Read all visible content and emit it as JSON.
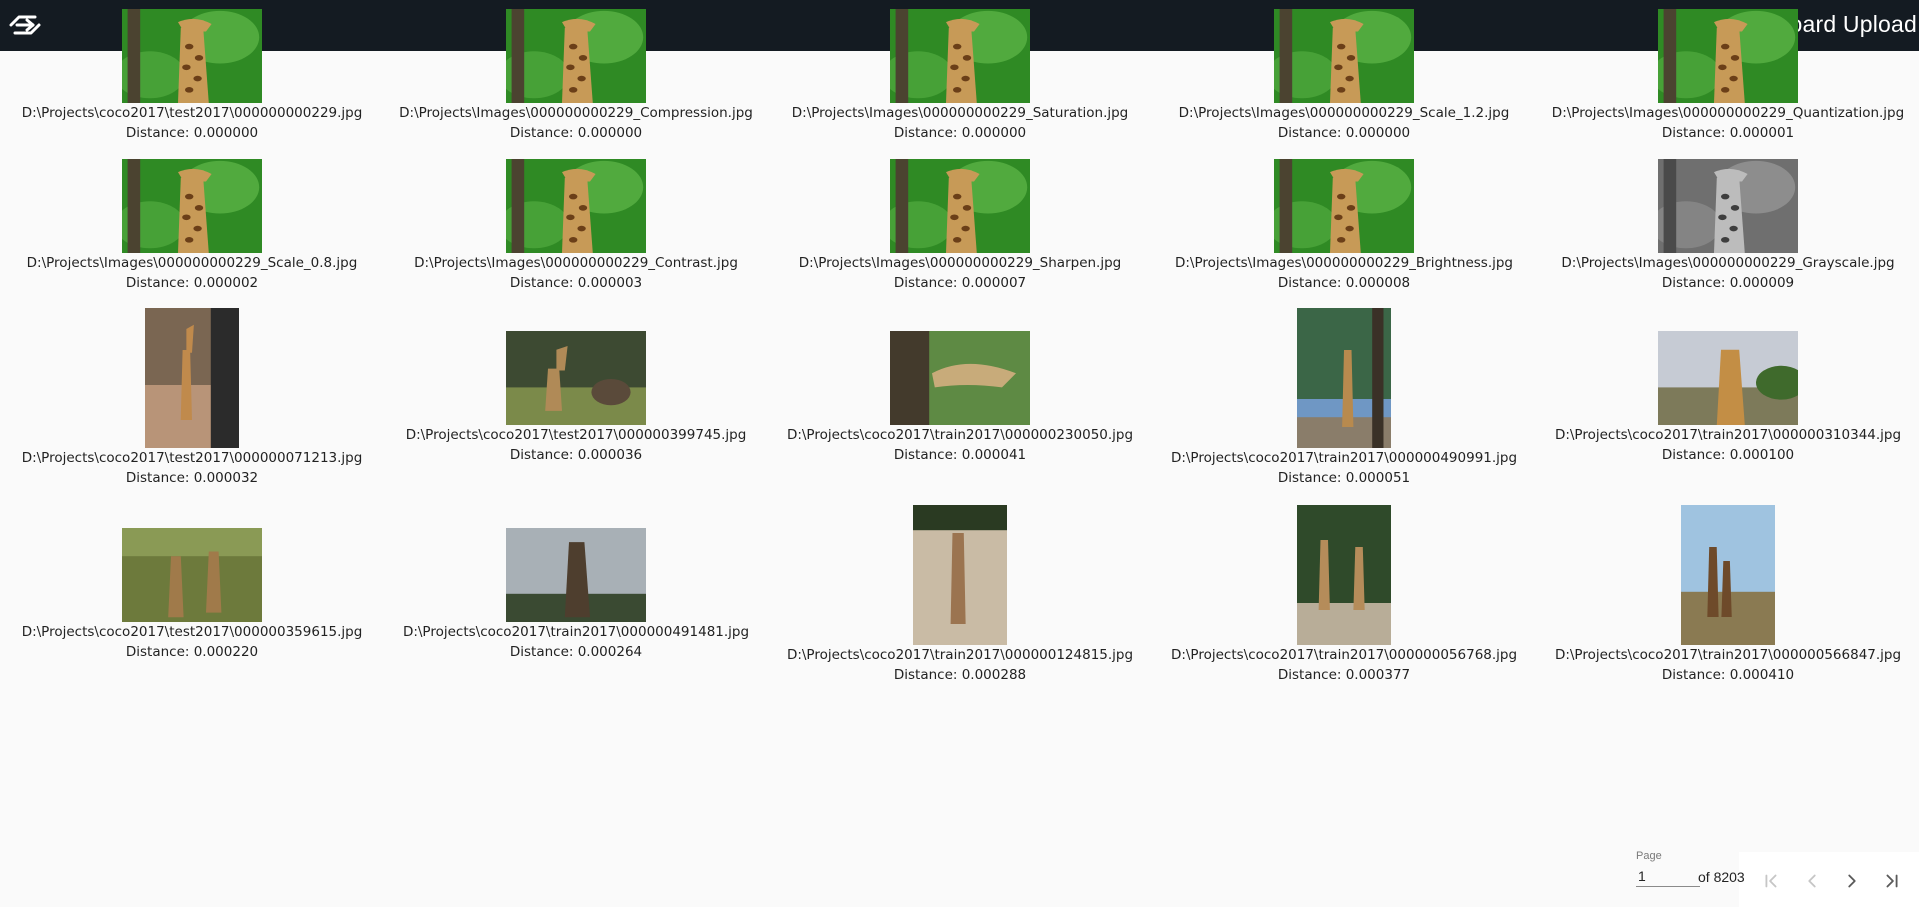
{
  "header": {
    "title": "Dashboard Upload",
    "logo_icon": "logo-icon"
  },
  "results": [
    {
      "path": "D:\\Projects\\coco2017\\test2017\\000000000229.jpg",
      "distance": "Distance: 0.000000",
      "image": "giraffe-trees"
    },
    {
      "path": "D:\\Projects\\Images\\000000000229_Compression.jpg",
      "distance": "Distance: 0.000000",
      "image": "giraffe-trees"
    },
    {
      "path": "D:\\Projects\\Images\\000000000229_Saturation.jpg",
      "distance": "Distance: 0.000000",
      "image": "giraffe-trees"
    },
    {
      "path": "D:\\Projects\\Images\\000000000229_Scale_1.2.jpg",
      "distance": "Distance: 0.000000",
      "image": "giraffe-trees"
    },
    {
      "path": "D:\\Projects\\Images\\000000000229_Quantization.jpg",
      "distance": "Distance: 0.000001",
      "image": "giraffe-trees"
    },
    {
      "path": "D:\\Projects\\Images\\000000000229_Scale_0.8.jpg",
      "distance": "Distance: 0.000002",
      "image": "giraffe-trees"
    },
    {
      "path": "D:\\Projects\\Images\\000000000229_Contrast.jpg",
      "distance": "Distance: 0.000003",
      "image": "giraffe-trees"
    },
    {
      "path": "D:\\Projects\\Images\\000000000229_Sharpen.jpg",
      "distance": "Distance: 0.000007",
      "image": "giraffe-trees"
    },
    {
      "path": "D:\\Projects\\Images\\000000000229_Brightness.jpg",
      "distance": "Distance: 0.000008",
      "image": "giraffe-trees"
    },
    {
      "path": "D:\\Projects\\Images\\000000000229_Grayscale.jpg",
      "distance": "Distance: 0.000009",
      "image": "giraffe-trees-gray"
    },
    {
      "path": "D:\\Projects\\coco2017\\test2017\\000000071213.jpg",
      "distance": "Distance: 0.000032",
      "image": "giraffe-enclosure"
    },
    {
      "path": "D:\\Projects\\coco2017\\test2017\\000000399745.jpg",
      "distance": "Distance: 0.000036",
      "image": "giraffe-grassland"
    },
    {
      "path": "D:\\Projects\\coco2017\\train2017\\000000230050.jpg",
      "distance": "Distance: 0.000041",
      "image": "giraffe-head"
    },
    {
      "path": "D:\\Projects\\coco2017\\train2017\\000000490991.jpg",
      "distance": "Distance: 0.000051",
      "image": "giraffe-tree-sky"
    },
    {
      "path": "D:\\Projects\\coco2017\\train2017\\000000310344.jpg",
      "distance": "Distance: 0.000100",
      "image": "giraffe-savanna"
    },
    {
      "path": "D:\\Projects\\coco2017\\test2017\\000000359615.jpg",
      "distance": "Distance: 0.000220",
      "image": "giraffes-bush"
    },
    {
      "path": "D:\\Projects\\coco2017\\train2017\\000000491481.jpg",
      "distance": "Distance: 0.000264",
      "image": "giraffe-cloudy"
    },
    {
      "path": "D:\\Projects\\coco2017\\train2017\\000000124815.jpg",
      "distance": "Distance: 0.000288",
      "image": "giraffe-dirt"
    },
    {
      "path": "D:\\Projects\\coco2017\\train2017\\000000056768.jpg",
      "distance": "Distance: 0.000377",
      "image": "giraffes-rocks"
    },
    {
      "path": "D:\\Projects\\coco2017\\train2017\\000000566847.jpg",
      "distance": "Distance: 0.000410",
      "image": "giraffes-plain"
    }
  ],
  "paginator": {
    "label": "Page",
    "value": "1",
    "of_text": "of 8203",
    "first_icon": "first-page-icon",
    "prev_icon": "chevron-left-icon",
    "next_icon": "chevron-right-icon",
    "last_icon": "last-page-icon"
  }
}
